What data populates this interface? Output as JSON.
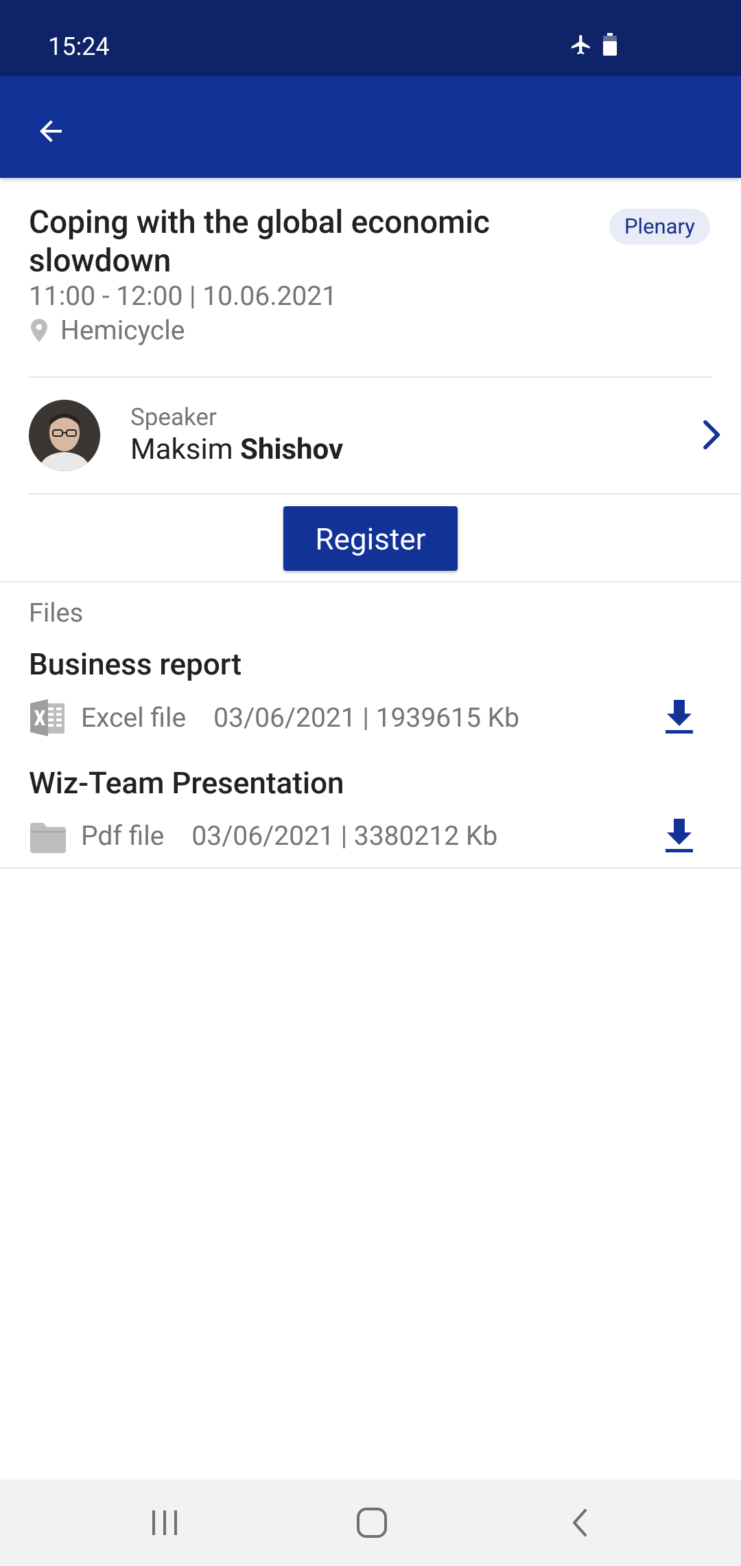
{
  "status_bar": {
    "time": "15:24",
    "icons": [
      "airplane-icon",
      "battery-icon"
    ]
  },
  "app_bar": {
    "back_icon": "arrow-left-icon"
  },
  "session": {
    "title": "Coping with the global economic slowdown",
    "badge": "Plenary",
    "time": "11:00 - 12:00 | 10.06.2021",
    "location": "Hemicycle"
  },
  "speaker": {
    "role": "Speaker",
    "first_name": "Maksim",
    "last_name": "Shishov"
  },
  "register": {
    "label": "Register"
  },
  "files": {
    "label": "Files",
    "items": [
      {
        "title": "Business report",
        "type": "Excel file",
        "meta": "03/06/2021 | 1939615 Kb",
        "icon": "excel-file-icon"
      },
      {
        "title": "Wiz-Team Presentation",
        "type": "Pdf file",
        "meta": "03/06/2021 | 3380212 Kb",
        "icon": "folder-icon"
      }
    ]
  },
  "colors": {
    "primary": "#133298",
    "status_bar": "#0f2468",
    "muted_text": "#757575",
    "badge_bg": "#e8ecf6"
  },
  "nav_bar": {
    "icons": [
      "recents-icon",
      "home-icon",
      "back-icon"
    ]
  }
}
